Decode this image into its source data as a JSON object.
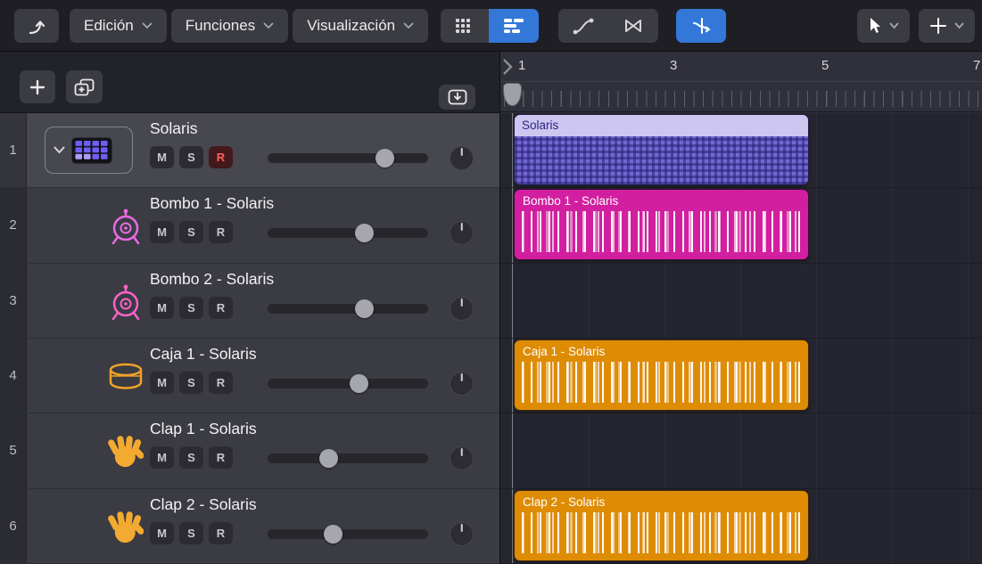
{
  "toolbar": {
    "menus": [
      {
        "label": "Edición"
      },
      {
        "label": "Funciones"
      },
      {
        "label": "Visualización"
      }
    ]
  },
  "ruler": {
    "bar_labels": [
      "1",
      "3",
      "5",
      "7"
    ]
  },
  "track_controls": {
    "mute": "M",
    "solo": "S",
    "record": "R"
  },
  "tracks": [
    {
      "num": "1",
      "name": "Solaris",
      "icon": "step-sequencer",
      "icon_color": "#6e5ef2",
      "parent": true,
      "selected": true,
      "record_armed": true,
      "volume_percent": 73
    },
    {
      "num": "2",
      "name": "Bombo 1 - Solaris",
      "icon": "kick-drum",
      "icon_color": "#e86ae4",
      "parent": false,
      "selected": false,
      "record_armed": false,
      "volume_percent": 60
    },
    {
      "num": "3",
      "name": "Bombo 2 - Solaris",
      "icon": "kick-drum",
      "icon_color": "#f563c8",
      "parent": false,
      "selected": false,
      "record_armed": false,
      "volume_percent": 60
    },
    {
      "num": "4",
      "name": "Caja 1 - Solaris",
      "icon": "snare-drum",
      "icon_color": "#f0a228",
      "parent": false,
      "selected": false,
      "record_armed": false,
      "volume_percent": 57
    },
    {
      "num": "5",
      "name": "Clap 1 - Solaris",
      "icon": "clap-hand",
      "icon_color": "#f3aa30",
      "parent": false,
      "selected": false,
      "record_armed": false,
      "volume_percent": 38
    },
    {
      "num": "6",
      "name": "Clap 2 - Solaris",
      "icon": "clap-hand",
      "icon_color": "#f3aa30",
      "parent": false,
      "selected": false,
      "record_armed": false,
      "volume_percent": 41
    }
  ],
  "regions": [
    {
      "lane": 0,
      "label": "Solaris",
      "style": "purple"
    },
    {
      "lane": 1,
      "label": "Bombo 1 - Solaris",
      "style": "magenta"
    },
    {
      "lane": 3,
      "label": "Caja 1 - Solaris",
      "style": "orange"
    },
    {
      "lane": 5,
      "label": "Clap 2 - Solaris",
      "style": "orange"
    }
  ],
  "colors": {
    "accent_blue": "#3378d8",
    "region_purple_body": "#7168d2",
    "region_purple_header": "#cdc6f0",
    "region_magenta": "#d11f9f",
    "region_orange": "#de8c04",
    "record_red": "#ff6259"
  }
}
